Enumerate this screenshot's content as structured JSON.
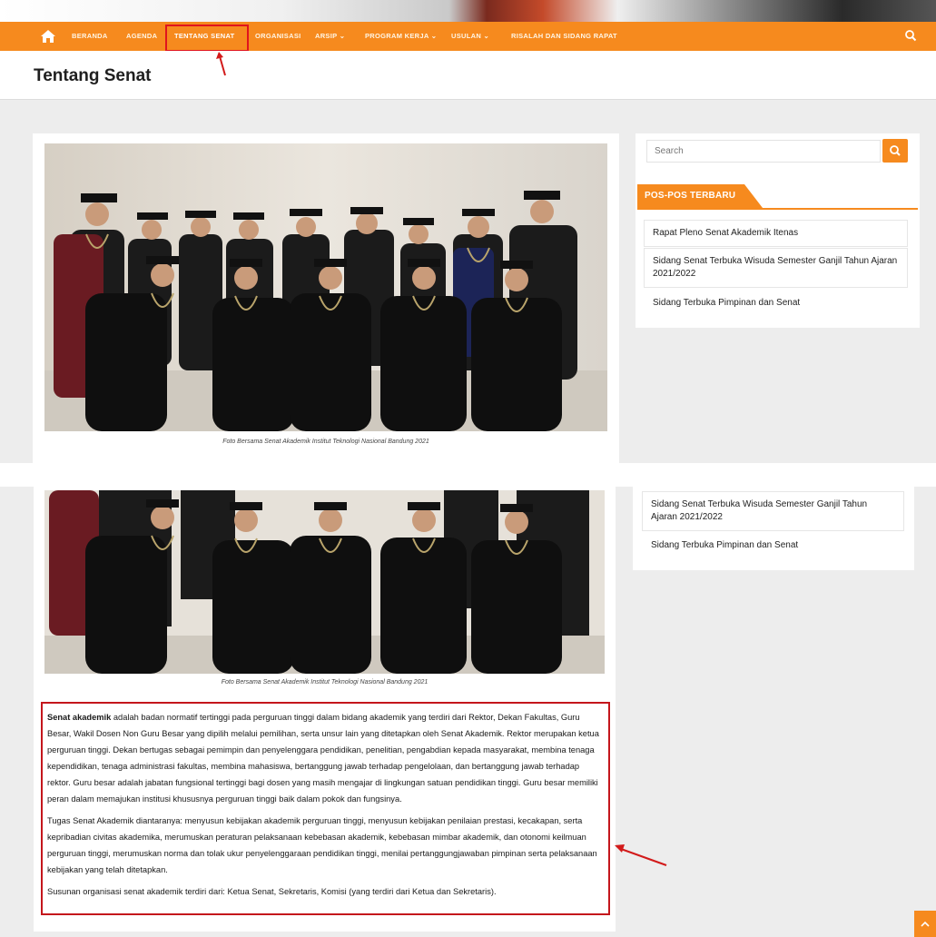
{
  "nav": {
    "items": [
      "BERANDA",
      "AGENDA",
      "TENTANG SENAT",
      "ORGANISASI",
      "ARSIP",
      "PROGRAM KERJA",
      "USULAN",
      "RISALAH DAN SIDANG RAPAT"
    ],
    "dropdown_marker": "⌄",
    "active": "TENTANG SENAT"
  },
  "page": {
    "title": "Tentang Senat"
  },
  "photo": {
    "caption": "Foto Bersama Senat Akademik Institut Teknologi Nasional Bandung 2021"
  },
  "sidebar": {
    "search_placeholder": "Search",
    "widget_title": "POS-POS TERBARU",
    "posts": [
      "Rapat Pleno Senat Akademik Itenas",
      "Sidang Senat Terbuka Wisuda Semester Ganjil Tahun Ajaran 2021/2022",
      "Sidang Terbuka Pimpinan dan Senat"
    ]
  },
  "content": {
    "p1_bold": "Senat akademik",
    "p1_rest": " adalah badan normatif tertinggi pada perguruan tinggi dalam bidang akademik yang terdiri dari Rektor, Dekan Fakultas, Guru Besar, Wakil Dosen Non Guru Besar yang dipilih melalui pemilihan, serta unsur lain yang ditetapkan oleh Senat Akademik. Rektor merupakan ketua perguruan tinggi. Dekan bertugas sebagai pemimpin dan penyelenggara pendidikan, penelitian, pengabdian kepada masyarakat, membina tenaga kependidikan, tenaga administrasi fakultas, membina mahasiswa, bertanggung jawab terhadap pengelolaan, dan bertanggung jawab terhadap rektor. Guru besar adalah jabatan fungsional tertinggi bagi dosen yang masih mengajar di lingkungan satuan pendidikan tinggi. Guru besar memiliki peran dalam memajukan institusi khususnya perguruan tinggi baik dalam pokok dan fungsinya.",
    "p2": "Tugas Senat Akademik diantaranya: menyusun kebijakan akademik perguruan tinggi, menyusun kebijakan penilaian prestasi, kecakapan, serta kepribadian civitas akademika, merumuskan peraturan pelaksanaan kebebasan akademik, kebebasan mimbar akademik, dan otonomi keilmuan perguruan tinggi, merumuskan norma dan tolak ukur penyelenggaraan pendidikan tinggi, menilai pertanggungjawaban pimpinan serta pelaksanaan kebijakan yang telah ditetapkan.",
    "p3": "Susunan organisasi senat akademik terdiri dari: Ketua Senat, Sekretaris, Komisi (yang terdiri dari Ketua dan Sekretaris)."
  },
  "colors": {
    "brand_orange": "#f68a1e",
    "annotation_red": "#c4161c"
  },
  "icons": [
    "home-icon",
    "search-icon",
    "chevron-up-icon"
  ]
}
